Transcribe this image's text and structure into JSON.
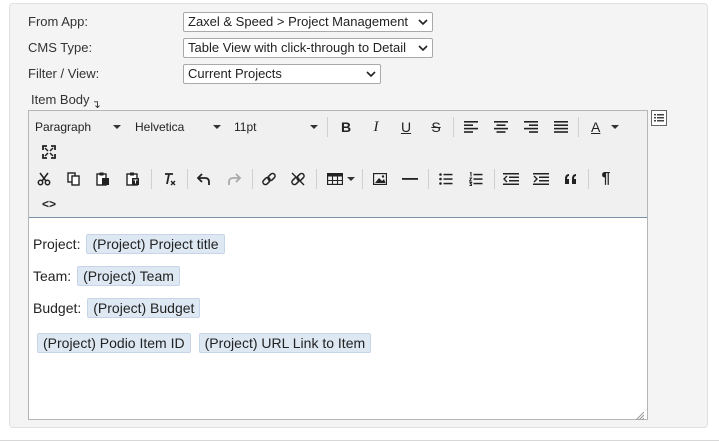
{
  "form": {
    "from_app": {
      "label": "From App:",
      "value": "Zaxel & Speed > Project Management"
    },
    "cms_type": {
      "label": "CMS Type:",
      "value": "Table View with click-through to Detail"
    },
    "filter_view": {
      "label": "Filter / View:",
      "value": "Current Projects"
    }
  },
  "item_body": {
    "label": "Item Body",
    "arrow": "↴"
  },
  "toolbar": {
    "block_format": "Paragraph",
    "font_family": "Helvetica",
    "font_size": "11pt",
    "bold": "B",
    "italic": "I",
    "underline": "U",
    "strikethrough": "S",
    "text_color": "A",
    "blockquote": "66",
    "pilcrow": "¶",
    "code": "<>"
  },
  "content": {
    "project_label": "Project:",
    "project_tag": "(Project) Project title",
    "team_label": "Team:",
    "team_tag": "(Project) Team",
    "budget_label": "Budget:",
    "budget_tag": "(Project) Budget",
    "item_id_tag": "(Project) Podio Item ID",
    "url_tag": "(Project) URL Link to Item"
  },
  "colors": {
    "tag_bg": "#dde8f3",
    "panel_bg": "#f4f4f4",
    "toolbar_bg": "#f0f0f0"
  }
}
